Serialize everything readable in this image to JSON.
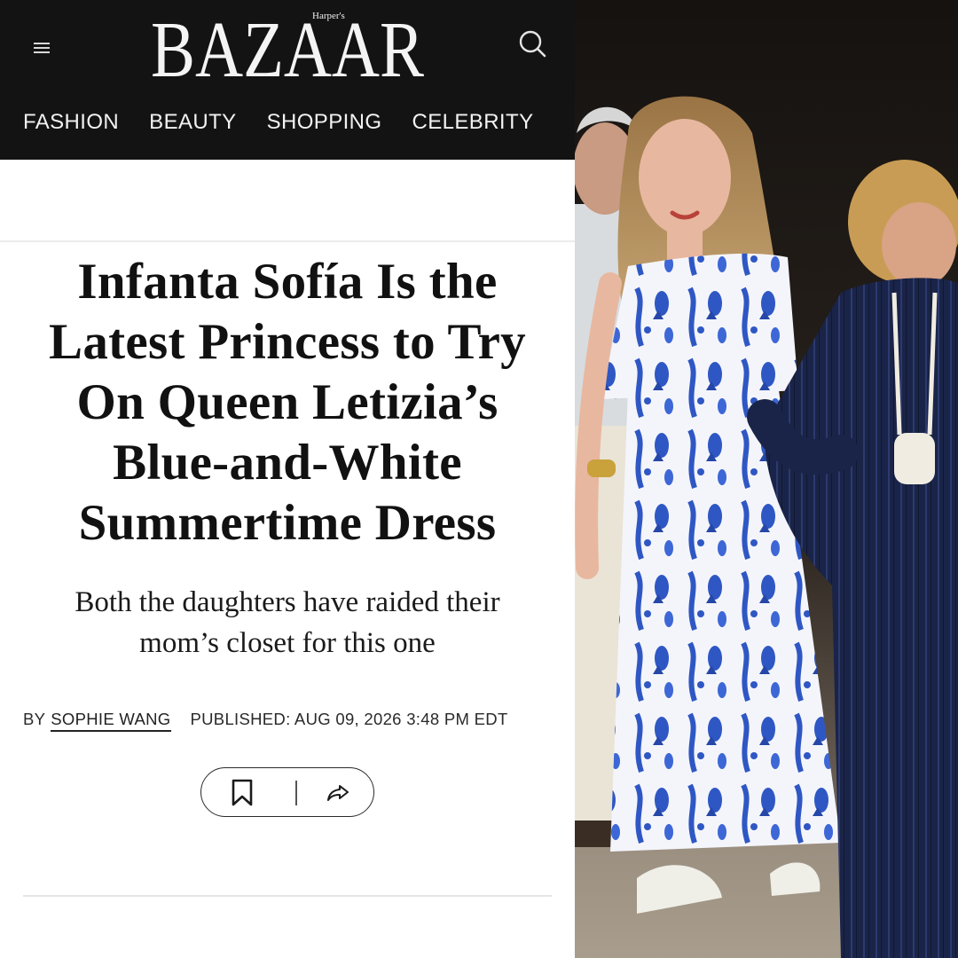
{
  "header": {
    "logo_small": "Harper's",
    "logo_text": "BAZAAR",
    "menu_icon": "hamburger-menu-icon",
    "search_icon": "search-icon",
    "background": "#131313"
  },
  "nav": {
    "items": [
      {
        "label": "FASHION"
      },
      {
        "label": "BEAUTY"
      },
      {
        "label": "SHOPPING"
      },
      {
        "label": "CELEBRITY"
      }
    ]
  },
  "article": {
    "headline_lines": [
      "Infanta Sofía Is the",
      "Latest Princess to Try",
      "On Queen Letizia’s",
      "Blue-and-White",
      "Summertime Dress"
    ],
    "dek_lines": [
      "Both the daughters have raided their",
      "mom’s closet for this one"
    ],
    "byline": {
      "prefix": "BY",
      "author": "SOPHIE WANG",
      "published": "PUBLISHED: AUG 09, 2026 3:48 PM EDT"
    },
    "actions": {
      "bookmark_icon": "bookmark-icon",
      "share_icon": "share-icon"
    }
  },
  "photo": {
    "subject": "woman in blue-and-white patterned off-shoulder maxi dress walking arm in arm",
    "dress_blue": "#2f57c4",
    "dress_white": "#f4f5fb",
    "navy": "#1a2448"
  }
}
